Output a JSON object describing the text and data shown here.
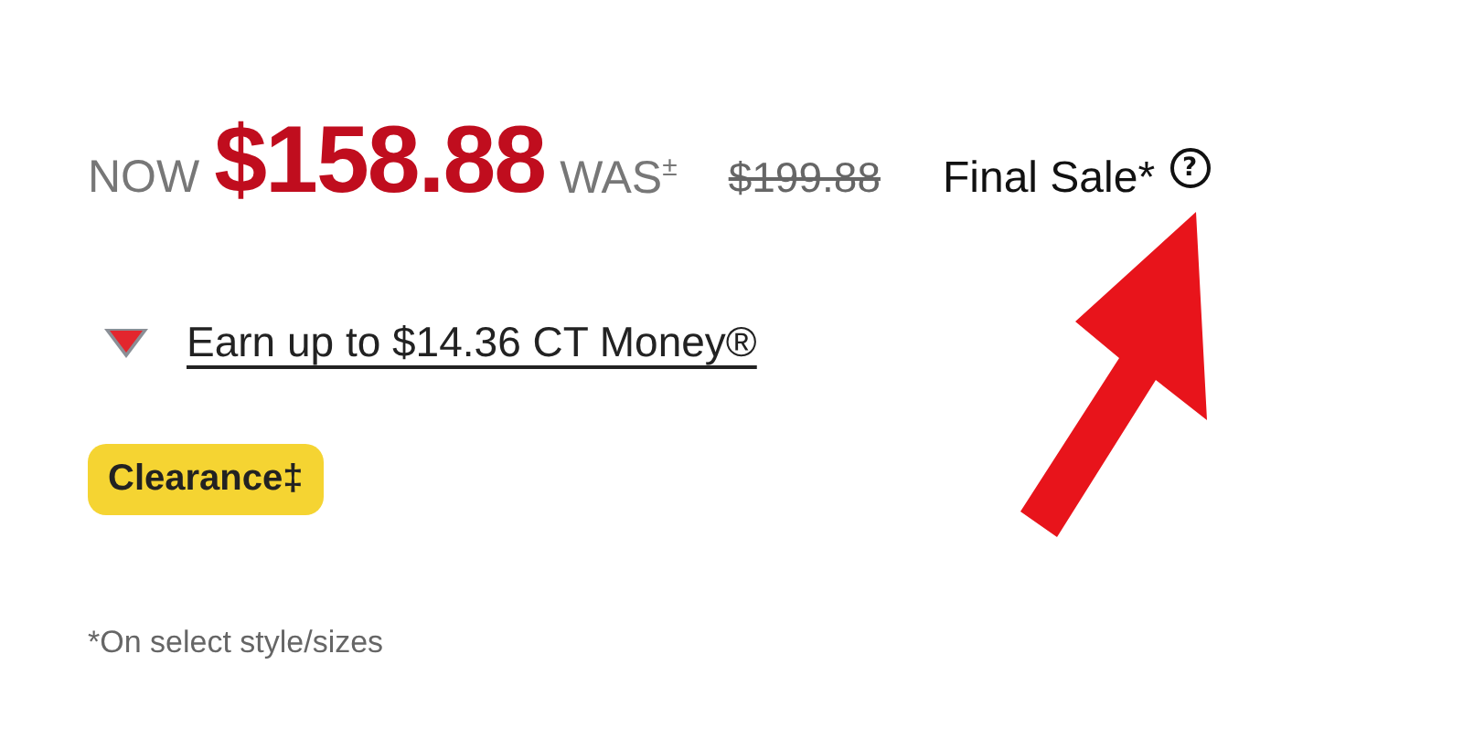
{
  "price": {
    "now_label": "NOW",
    "now_price": "$158.88",
    "was_label": "WAS$^{±}$",
    "was_price": "$199.88",
    "final_sale": "Final Sale*",
    "help_icon": "?"
  },
  "rewards": {
    "link": "Earn up to $14.36 CT Money®"
  },
  "badge": {
    "label": "Clearance‡"
  },
  "footnote": "*On select style/sizes"
}
